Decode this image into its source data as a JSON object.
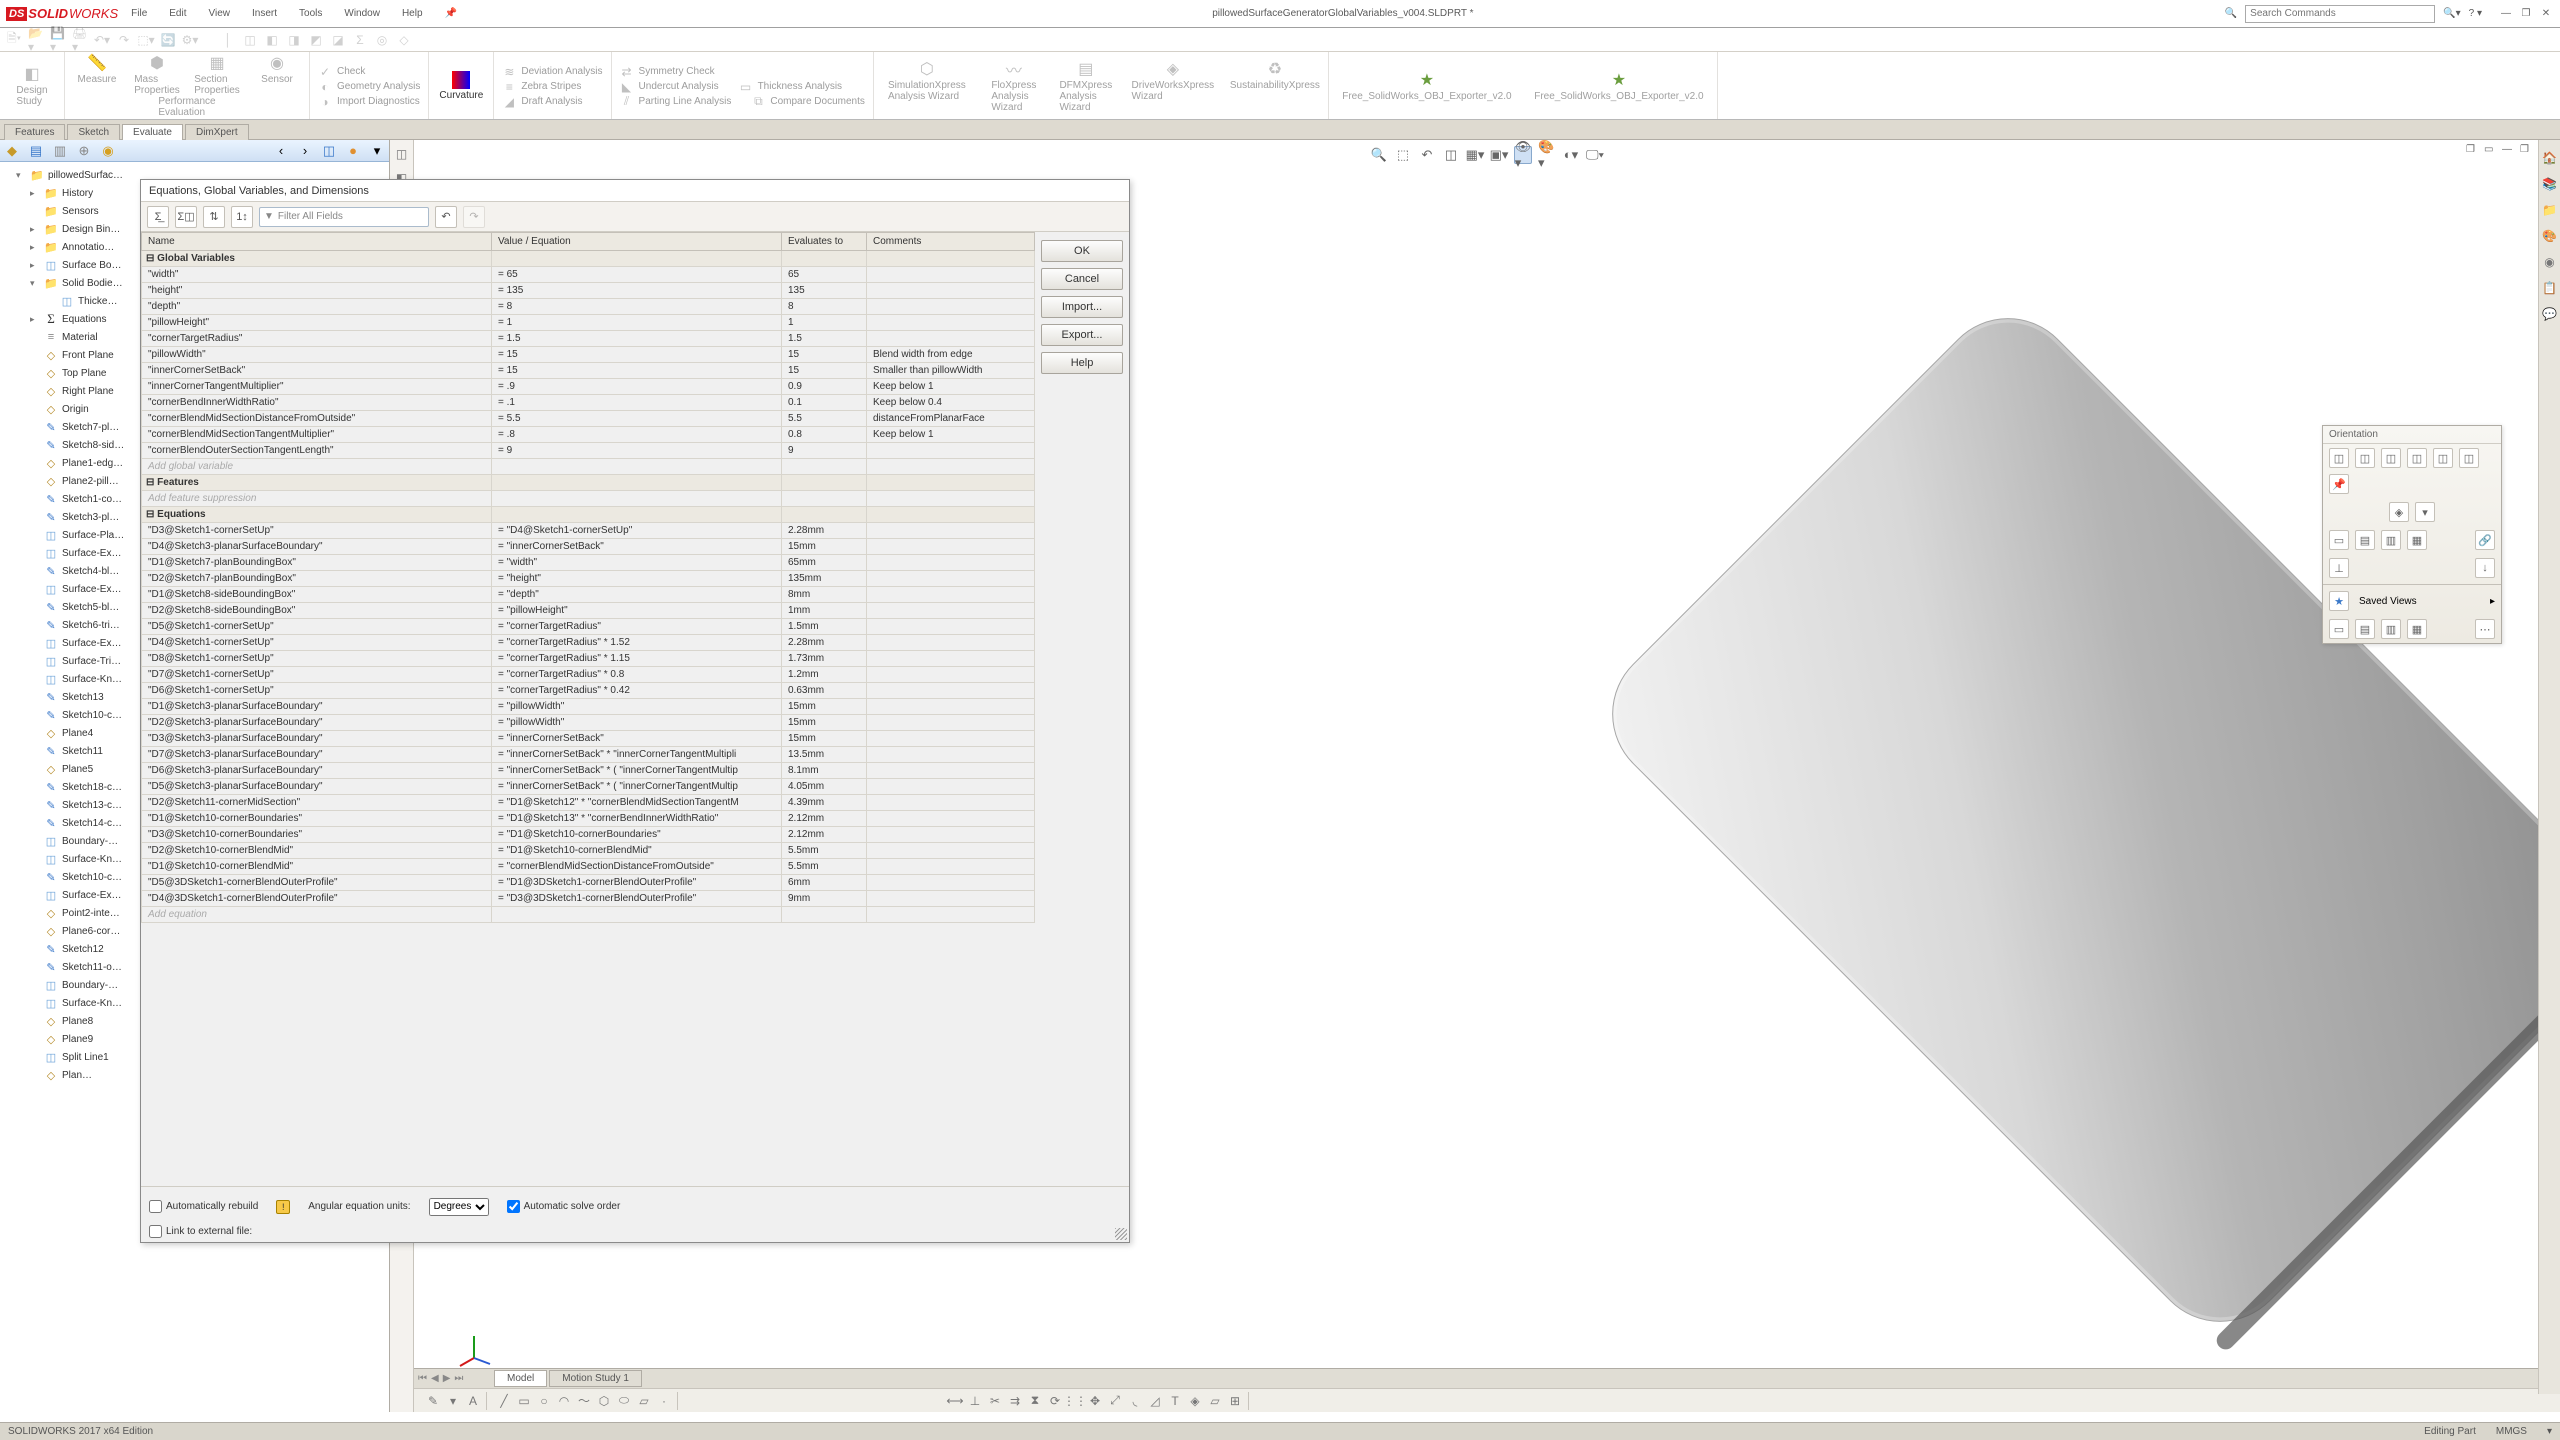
{
  "title": "pillowedSurfaceGeneratorGlobalVariables_v004.SLDPRT *",
  "menus": [
    "File",
    "Edit",
    "View",
    "Insert",
    "Tools",
    "Window",
    "Help"
  ],
  "search_placeholder": "Search Commands",
  "ribbon": {
    "groups": [
      {
        "cells": [
          {
            "label": "Design\nStudy"
          }
        ]
      },
      {
        "cells": [
          {
            "label": "Measure"
          },
          {
            "label": "Mass\nProperties"
          },
          {
            "label": "Section\nProperties"
          },
          {
            "label": "Sensor"
          }
        ],
        "footer": "Performance\nEvaluation"
      },
      {
        "lines": [
          [
            "Check"
          ],
          [
            "Geometry Analysis"
          ],
          [
            "Import Diagnostics"
          ]
        ]
      },
      {
        "cells": [
          {
            "label": "Curvature",
            "color": true
          }
        ]
      },
      {
        "lines": [
          [
            "Deviation Analysis"
          ],
          [
            "Zebra Stripes"
          ],
          [
            "Draft Analysis"
          ]
        ]
      },
      {
        "lines": [
          [
            "Symmetry Check"
          ],
          [
            "Undercut Analysis",
            "Thickness Analysis"
          ],
          [
            "Parting Line Analysis",
            "Compare Documents"
          ]
        ]
      },
      {
        "cells": [
          {
            "label": "SimulationXpress\nAnalysis Wizard"
          },
          {
            "label": "FloXpress\nAnalysis\nWizard"
          },
          {
            "label": "DFMXpress\nAnalysis\nWizard"
          },
          {
            "label": "DriveWorksXpress\nWizard"
          },
          {
            "label": "SustainabilityXpress"
          }
        ]
      },
      {
        "cells": [
          {
            "label": "Free_SolidWorks_OBJ_Exporter_v2.0",
            "grn": true
          },
          {
            "label": "Free_SolidWorks_OBJ_Exporter_v2.0",
            "grn": true
          }
        ]
      }
    ]
  },
  "tabs": [
    "Features",
    "Sketch",
    "Evaluate",
    "DimXpert"
  ],
  "active_tab": "Evaluate",
  "feature_tree": [
    {
      "t": "pillowedSurfac…",
      "ico": "fold",
      "lvl": 0,
      "arr": "▾"
    },
    {
      "t": "History",
      "ico": "fold",
      "lvl": 1,
      "arr": "▸"
    },
    {
      "t": "Sensors",
      "ico": "fold",
      "lvl": 1
    },
    {
      "t": "Design Bin…",
      "ico": "fold",
      "lvl": 1,
      "arr": "▸"
    },
    {
      "t": "Annotatio…",
      "ico": "fold",
      "lvl": 1,
      "arr": "▸"
    },
    {
      "t": "Surface Bo…",
      "ico": "surf",
      "lvl": 1,
      "arr": "▸"
    },
    {
      "t": "Solid Bodie…",
      "ico": "fold",
      "lvl": 1,
      "arr": "▾"
    },
    {
      "t": "Thicke…",
      "ico": "surf",
      "lvl": 2
    },
    {
      "t": "Equations",
      "ico": "sigma",
      "lvl": 1,
      "arr": "▸"
    },
    {
      "t": "Material <n…",
      "ico": "mat",
      "lvl": 1
    },
    {
      "t": "Front Plane",
      "ico": "plane",
      "lvl": 1
    },
    {
      "t": "Top Plane",
      "ico": "plane",
      "lvl": 1
    },
    {
      "t": "Right Plane",
      "ico": "plane",
      "lvl": 1
    },
    {
      "t": "Origin",
      "ico": "plane",
      "lvl": 1
    },
    {
      "t": "Sketch7-pl…",
      "ico": "sketch",
      "lvl": 1
    },
    {
      "t": "Sketch8-sid…",
      "ico": "sketch",
      "lvl": 1
    },
    {
      "t": "Plane1-edg…",
      "ico": "plane",
      "lvl": 1
    },
    {
      "t": "Plane2-pill…",
      "ico": "plane",
      "lvl": 1
    },
    {
      "t": "Sketch1-co…",
      "ico": "sketch",
      "lvl": 1
    },
    {
      "t": "Sketch3-pl…",
      "ico": "sketch",
      "lvl": 1
    },
    {
      "t": "Surface-Pla…",
      "ico": "surf",
      "lvl": 1
    },
    {
      "t": "Surface-Ex…",
      "ico": "surf",
      "lvl": 1
    },
    {
      "t": "Sketch4-bl…",
      "ico": "sketch",
      "lvl": 1
    },
    {
      "t": "Surface-Ex…",
      "ico": "surf",
      "lvl": 1
    },
    {
      "t": "Sketch5-bl…",
      "ico": "sketch",
      "lvl": 1
    },
    {
      "t": "Sketch6-tri…",
      "ico": "sketch",
      "lvl": 1
    },
    {
      "t": "Surface-Ex…",
      "ico": "surf",
      "lvl": 1
    },
    {
      "t": "Surface-Tri…",
      "ico": "surf",
      "lvl": 1
    },
    {
      "t": "Surface-Kn…",
      "ico": "surf",
      "lvl": 1
    },
    {
      "t": "Sketch13",
      "ico": "sketch",
      "lvl": 1
    },
    {
      "t": "Sketch10-c…",
      "ico": "sketch",
      "lvl": 1
    },
    {
      "t": "Plane4",
      "ico": "plane",
      "lvl": 1
    },
    {
      "t": "Sketch11",
      "ico": "sketch",
      "lvl": 1
    },
    {
      "t": "Plane5",
      "ico": "plane",
      "lvl": 1
    },
    {
      "t": "Sketch18-c…",
      "ico": "sketch",
      "lvl": 1
    },
    {
      "t": "Sketch13-c…",
      "ico": "sketch",
      "lvl": 1
    },
    {
      "t": "Sketch14-c…",
      "ico": "sketch",
      "lvl": 1
    },
    {
      "t": "Boundary-…",
      "ico": "surf",
      "lvl": 1
    },
    {
      "t": "Surface-Kn…",
      "ico": "surf",
      "lvl": 1
    },
    {
      "t": "Sketch10-c…",
      "ico": "sketch",
      "lvl": 1
    },
    {
      "t": "Surface-Ex…",
      "ico": "surf",
      "lvl": 1
    },
    {
      "t": "Point2-inte…",
      "ico": "plane",
      "lvl": 1
    },
    {
      "t": "Plane6-cor…",
      "ico": "plane",
      "lvl": 1
    },
    {
      "t": "Sketch12",
      "ico": "sketch",
      "lvl": 1
    },
    {
      "t": "Sketch11-o…",
      "ico": "sketch",
      "lvl": 1
    },
    {
      "t": "Boundary-…",
      "ico": "surf",
      "lvl": 1
    },
    {
      "t": "Surface-Kn…",
      "ico": "surf",
      "lvl": 1
    },
    {
      "t": "Plane8",
      "ico": "plane",
      "lvl": 1
    },
    {
      "t": "Plane9",
      "ico": "plane",
      "lvl": 1
    },
    {
      "t": "Split Line1",
      "ico": "surf",
      "lvl": 1
    },
    {
      "t": "Plan…",
      "ico": "plane",
      "lvl": 1
    }
  ],
  "dialog": {
    "title": "Equations, Global Variables, and Dimensions",
    "filter_placeholder": "Filter All Fields",
    "buttons": [
      "OK",
      "Cancel",
      "Import...",
      "Export...",
      "Help"
    ],
    "headers": [
      "Name",
      "Value / Equation",
      "Evaluates to",
      "Comments"
    ],
    "globals": [
      {
        "n": "\"width\"",
        "v": "= 65",
        "e": "65",
        "c": ""
      },
      {
        "n": "\"height\"",
        "v": "= 135",
        "e": "135",
        "c": ""
      },
      {
        "n": "\"depth\"",
        "v": "= 8",
        "e": "8",
        "c": ""
      },
      {
        "n": "\"pillowHeight\"",
        "v": "= 1",
        "e": "1",
        "c": ""
      },
      {
        "n": "\"cornerTargetRadius\"",
        "v": "= 1.5",
        "e": "1.5",
        "c": ""
      },
      {
        "n": "\"pillowWidth\"",
        "v": "= 15",
        "e": "15",
        "c": "Blend width from edge"
      },
      {
        "n": "\"innerCornerSetBack\"",
        "v": "= 15",
        "e": "15",
        "c": "Smaller than pillowWidth"
      },
      {
        "n": "\"innerCornerTangentMultiplier\"",
        "v": "= .9",
        "e": "0.9",
        "c": "Keep below 1"
      },
      {
        "n": "\"cornerBendInnerWidthRatio\"",
        "v": "= .1",
        "e": "0.1",
        "c": "Keep below 0.4"
      },
      {
        "n": "\"cornerBlendMidSectionDistanceFromOutside\"",
        "v": "= 5.5",
        "e": "5.5",
        "c": "distanceFromPlanarFace"
      },
      {
        "n": "\"cornerBlendMidSectionTangentMultiplier\"",
        "v": "= .8",
        "e": "0.8",
        "c": "Keep below 1"
      },
      {
        "n": "\"cornerBlendOuterSectionTangentLength\"",
        "v": "= 9",
        "e": "9",
        "c": ""
      }
    ],
    "add_gv": "Add global variable",
    "features_label": "Features",
    "add_fs": "Add feature suppression",
    "equations_label": "Equations",
    "equations": [
      {
        "n": "\"D3@Sketch1-cornerSetUp\"",
        "v": "= \"D4@Sketch1-cornerSetUp\"",
        "e": "2.28mm"
      },
      {
        "n": "\"D4@Sketch3-planarSurfaceBoundary\"",
        "v": "= \"innerCornerSetBack\"",
        "e": "15mm"
      },
      {
        "n": "\"D1@Sketch7-planBoundingBox\"",
        "v": "= \"width\"",
        "e": "65mm"
      },
      {
        "n": "\"D2@Sketch7-planBoundingBox\"",
        "v": "= \"height\"",
        "e": "135mm"
      },
      {
        "n": "\"D1@Sketch8-sideBoundingBox\"",
        "v": "= \"depth\"",
        "e": "8mm"
      },
      {
        "n": "\"D2@Sketch8-sideBoundingBox\"",
        "v": "= \"pillowHeight\"",
        "e": "1mm"
      },
      {
        "n": "\"D5@Sketch1-cornerSetUp\"",
        "v": "= \"cornerTargetRadius\"",
        "e": "1.5mm"
      },
      {
        "n": "\"D4@Sketch1-cornerSetUp\"",
        "v": "= \"cornerTargetRadius\" * 1.52",
        "e": "2.28mm"
      },
      {
        "n": "\"D8@Sketch1-cornerSetUp\"",
        "v": "= \"cornerTargetRadius\" * 1.15",
        "e": "1.73mm"
      },
      {
        "n": "\"D7@Sketch1-cornerSetUp\"",
        "v": "= \"cornerTargetRadius\" * 0.8",
        "e": "1.2mm"
      },
      {
        "n": "\"D6@Sketch1-cornerSetUp\"",
        "v": "= \"cornerTargetRadius\" * 0.42",
        "e": "0.63mm"
      },
      {
        "n": "\"D1@Sketch3-planarSurfaceBoundary\"",
        "v": "= \"pillowWidth\"",
        "e": "15mm"
      },
      {
        "n": "\"D2@Sketch3-planarSurfaceBoundary\"",
        "v": "= \"pillowWidth\"",
        "e": "15mm"
      },
      {
        "n": "\"D3@Sketch3-planarSurfaceBoundary\"",
        "v": "= \"innerCornerSetBack\"",
        "e": "15mm"
      },
      {
        "n": "\"D7@Sketch3-planarSurfaceBoundary\"",
        "v": "= \"innerCornerSetBack\" * \"innerCornerTangentMultipli",
        "e": "13.5mm"
      },
      {
        "n": "\"D6@Sketch3-planarSurfaceBoundary\"",
        "v": "= \"innerCornerSetBack\" * ( \"innerCornerTangentMultip",
        "e": "8.1mm"
      },
      {
        "n": "\"D5@Sketch3-planarSurfaceBoundary\"",
        "v": "= \"innerCornerSetBack\" * ( \"innerCornerTangentMultip",
        "e": "4.05mm"
      },
      {
        "n": "\"D2@Sketch11-cornerMidSection\"",
        "v": "= \"D1@Sketch12\" * \"cornerBlendMidSectionTangentM",
        "e": "4.39mm"
      },
      {
        "n": "\"D1@Sketch10-cornerBoundaries\"",
        "v": "= \"D1@Sketch13\" * \"cornerBendInnerWidthRatio\"",
        "e": "2.12mm"
      },
      {
        "n": "\"D3@Sketch10-cornerBoundaries\"",
        "v": "= \"D1@Sketch10-cornerBoundaries\"",
        "e": "2.12mm"
      },
      {
        "n": "\"D2@Sketch10-cornerBlendMid\"",
        "v": "= \"D1@Sketch10-cornerBlendMid\"",
        "e": "5.5mm"
      },
      {
        "n": "\"D1@Sketch10-cornerBlendMid\"",
        "v": "= \"cornerBlendMidSectionDistanceFromOutside\"",
        "e": "5.5mm"
      },
      {
        "n": "\"D5@3DSketch1-cornerBlendOuterProfile\"",
        "v": "= \"D1@3DSketch1-cornerBlendOuterProfile\"",
        "e": "6mm"
      },
      {
        "n": "\"D4@3DSketch1-cornerBlendOuterProfile\"",
        "v": "= \"D3@3DSketch1-cornerBlendOuterProfile\"",
        "e": "9mm"
      }
    ],
    "add_eq": "Add equation",
    "footer": {
      "auto_rebuild": "Automatically rebuild",
      "link_ext": "Link to external file:",
      "ang_units": "Angular equation units:",
      "units_val": "Degrees",
      "auto_solve": "Automatic solve order"
    }
  },
  "orientation": {
    "title": "Orientation",
    "saved": "Saved Views"
  },
  "bottom_tabs": [
    "Model",
    "Motion Study 1"
  ],
  "status": {
    "left": "SOLIDWORKS 2017 x64 Edition",
    "right1": "Editing Part",
    "right2": "MMGS"
  }
}
